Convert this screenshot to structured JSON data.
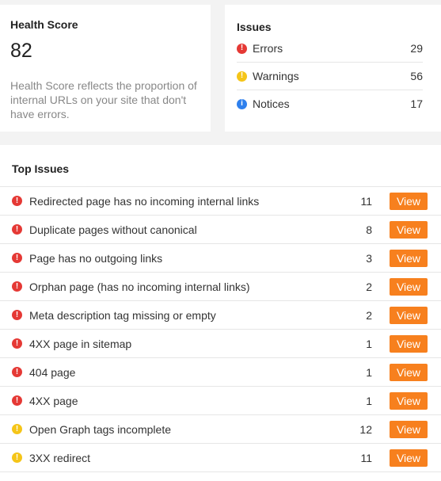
{
  "health": {
    "title": "Health Score",
    "score": "82",
    "description": "Health Score reflects the proportion of internal URLs on your site that don't have errors."
  },
  "issues": {
    "title": "Issues",
    "rows": [
      {
        "icon": "error-icon",
        "label": "Errors",
        "count": "29"
      },
      {
        "icon": "warning-icon",
        "label": "Warnings",
        "count": "56"
      },
      {
        "icon": "notice-icon",
        "label": "Notices",
        "count": "17"
      }
    ]
  },
  "top_issues": {
    "title": "Top Issues",
    "view_label": "View",
    "rows": [
      {
        "severity": "error",
        "label": "Redirected page has no incoming internal links",
        "count": "11"
      },
      {
        "severity": "error",
        "label": "Duplicate pages without canonical",
        "count": "8"
      },
      {
        "severity": "error",
        "label": "Page has no outgoing links",
        "count": "3"
      },
      {
        "severity": "error",
        "label": "Orphan page (has no incoming internal links)",
        "count": "2"
      },
      {
        "severity": "error",
        "label": "Meta description tag missing or empty",
        "count": "2"
      },
      {
        "severity": "error",
        "label": "4XX page in sitemap",
        "count": "1"
      },
      {
        "severity": "error",
        "label": "404 page",
        "count": "1"
      },
      {
        "severity": "error",
        "label": "4XX page",
        "count": "1"
      },
      {
        "severity": "warning",
        "label": "Open Graph tags incomplete",
        "count": "12"
      },
      {
        "severity": "warning",
        "label": "3XX redirect",
        "count": "11"
      }
    ]
  },
  "colors": {
    "error": "#e53935",
    "warning": "#f5c518",
    "notice": "#2f80ed",
    "button": "#f7801e"
  }
}
